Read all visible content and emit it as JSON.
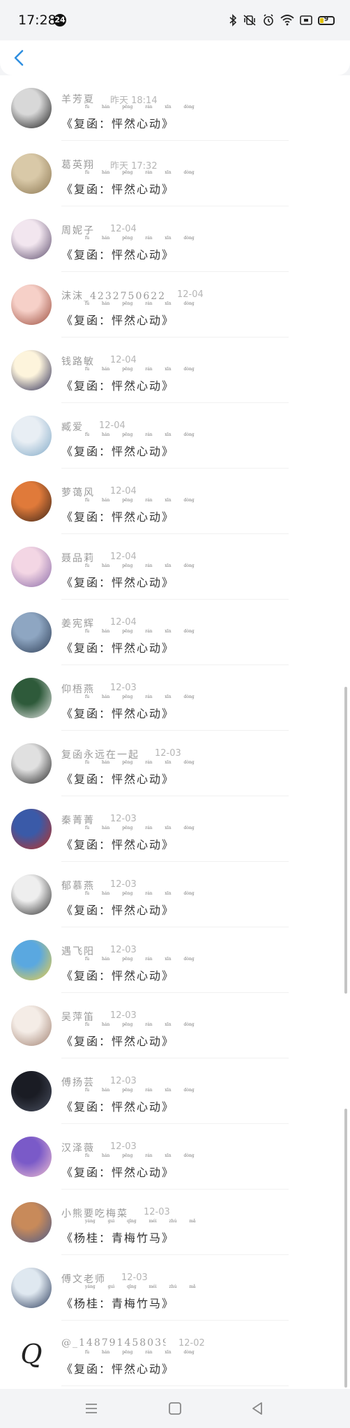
{
  "status_bar": {
    "time": "17:28",
    "notification_count": "24",
    "battery": "9",
    "icons": [
      "bluetooth-icon",
      "vibrate-icon",
      "alarm-icon",
      "wifi-icon",
      "screen-icon",
      "battery-icon"
    ]
  },
  "header": {
    "back_icon": "chevron-left-icon"
  },
  "nav": {
    "icons": [
      "menu-icon",
      "home-icon",
      "back-triangle-icon"
    ]
  },
  "items": [
    {
      "name": "羊芳夏",
      "time": "昨天 18:14",
      "message": "《复函：怦然心动》",
      "pinyin": "fù hán pēng rán xīn dòng",
      "avatar_colors": [
        "#d8d8d8",
        "#1a1a1a"
      ]
    },
    {
      "name": "葛英翔",
      "time": "昨天 17:32",
      "message": "《复函：怦然心动》",
      "pinyin": "fù hán pēng rán xīn dòng",
      "avatar_colors": [
        "#d9c9a8",
        "#8a7550"
      ]
    },
    {
      "name": "周妮子",
      "time": "12-04",
      "message": "《复函：怦然心动》",
      "pinyin": "fù hán pēng rán xīn dòng",
      "avatar_colors": [
        "#f2e6ef",
        "#5a4a6a"
      ]
    },
    {
      "name": "沫沫_4232750622…",
      "time": "12-04",
      "message": "《复函：怦然心动》",
      "pinyin": "fù hán pēng rán xīn dòng",
      "avatar_colors": [
        "#f6d0c8",
        "#9a4a3a"
      ]
    },
    {
      "name": "钱路敏",
      "time": "12-04",
      "message": "《复函：怦然心动》",
      "pinyin": "fù hán pēng rán xīn dòng",
      "avatar_colors": [
        "#fdf4dc",
        "#2a2a55"
      ]
    },
    {
      "name": "臧爱",
      "time": "12-04",
      "message": "《复函：怦然心动》",
      "pinyin": "fù hán pēng rán xīn dòng",
      "avatar_colors": [
        "#e8eef4",
        "#7fa8c6"
      ]
    },
    {
      "name": "萝蔼风",
      "time": "12-04",
      "message": "《复函：怦然心动》",
      "pinyin": "fù hán pēng rán xīn dòng",
      "avatar_colors": [
        "#e07a3a",
        "#3a2418"
      ]
    },
    {
      "name": "聂品莉",
      "time": "12-04",
      "message": "《复函：怦然心动》",
      "pinyin": "fù hán pēng rán xīn dòng",
      "avatar_colors": [
        "#f3d6e4",
        "#8a6aa8"
      ]
    },
    {
      "name": "姜宪辉",
      "time": "12-04",
      "message": "《复函：怦然心动》",
      "pinyin": "fù hán pēng rán xīn dòng",
      "avatar_colors": [
        "#8ea6c2",
        "#2e3e56"
      ]
    },
    {
      "name": "仰梧燕",
      "time": "12-03",
      "message": "《复函：怦然心动》",
      "pinyin": "fù hán pēng rán xīn dòng",
      "avatar_colors": [
        "#2e5a3a",
        "#e8e8e8"
      ]
    },
    {
      "name": "复函永远在一起",
      "time": "12-03",
      "message": "《复函：怦然心动》",
      "pinyin": "fù hán pēng rán xīn dòng",
      "avatar_colors": [
        "#e0e0e0",
        "#222222"
      ]
    },
    {
      "name": "秦菁菁",
      "time": "12-03",
      "message": "《复函：怦然心动》",
      "pinyin": "fù hán pēng rán xīn dòng",
      "avatar_colors": [
        "#3a5aa8",
        "#c03020"
      ]
    },
    {
      "name": "郁慕燕",
      "time": "12-03",
      "message": "《复函：怦然心动》",
      "pinyin": "fù hán pēng rán xīn dòng",
      "avatar_colors": [
        "#eeeeee",
        "#2a2a2a"
      ]
    },
    {
      "name": "遇飞阳",
      "time": "12-03",
      "message": "《复函：怦然心动》",
      "pinyin": "fù hán pēng rán xīn dòng",
      "avatar_colors": [
        "#5aa8e0",
        "#f0d040"
      ]
    },
    {
      "name": "吴萍笛",
      "time": "12-03",
      "message": "《复函：怦然心动》",
      "pinyin": "fù hán pēng rán xīn dòng",
      "avatar_colors": [
        "#f4ece6",
        "#a08070"
      ]
    },
    {
      "name": "傅扬芸",
      "time": "12-03",
      "message": "《复函：怦然心动》",
      "pinyin": "fù hán pēng rán xīn dòng",
      "avatar_colors": [
        "#1a1c24",
        "#4a5060"
      ]
    },
    {
      "name": "汉泽薇",
      "time": "12-03",
      "message": "《复函：怦然心动》",
      "pinyin": "fù hán pēng rán xīn dòng",
      "avatar_colors": [
        "#7a5ac8",
        "#f0c0d0"
      ]
    },
    {
      "name": "小熊要吃梅菜",
      "time": "12-03",
      "message": "《杨桂：青梅竹马》",
      "pinyin": "yáng guì qīng méi zhú mǎ",
      "avatar_colors": [
        "#c88a5a",
        "#4a5a8a"
      ]
    },
    {
      "name": "傅文老师",
      "time": "12-03",
      "message": "《杨桂：青梅竹马》",
      "pinyin": "yáng guì qīng méi zhú mǎ",
      "avatar_colors": [
        "#dfe8f0",
        "#2a3a5a"
      ]
    },
    {
      "name": "@_1487914580395…",
      "time": "12-02",
      "message": "《复函：怦然心动》",
      "pinyin": "fù hán pēng rán xīn dòng",
      "avatar_letter": "Q",
      "avatar_colors": [
        "#ffffff",
        "#222222"
      ]
    }
  ]
}
